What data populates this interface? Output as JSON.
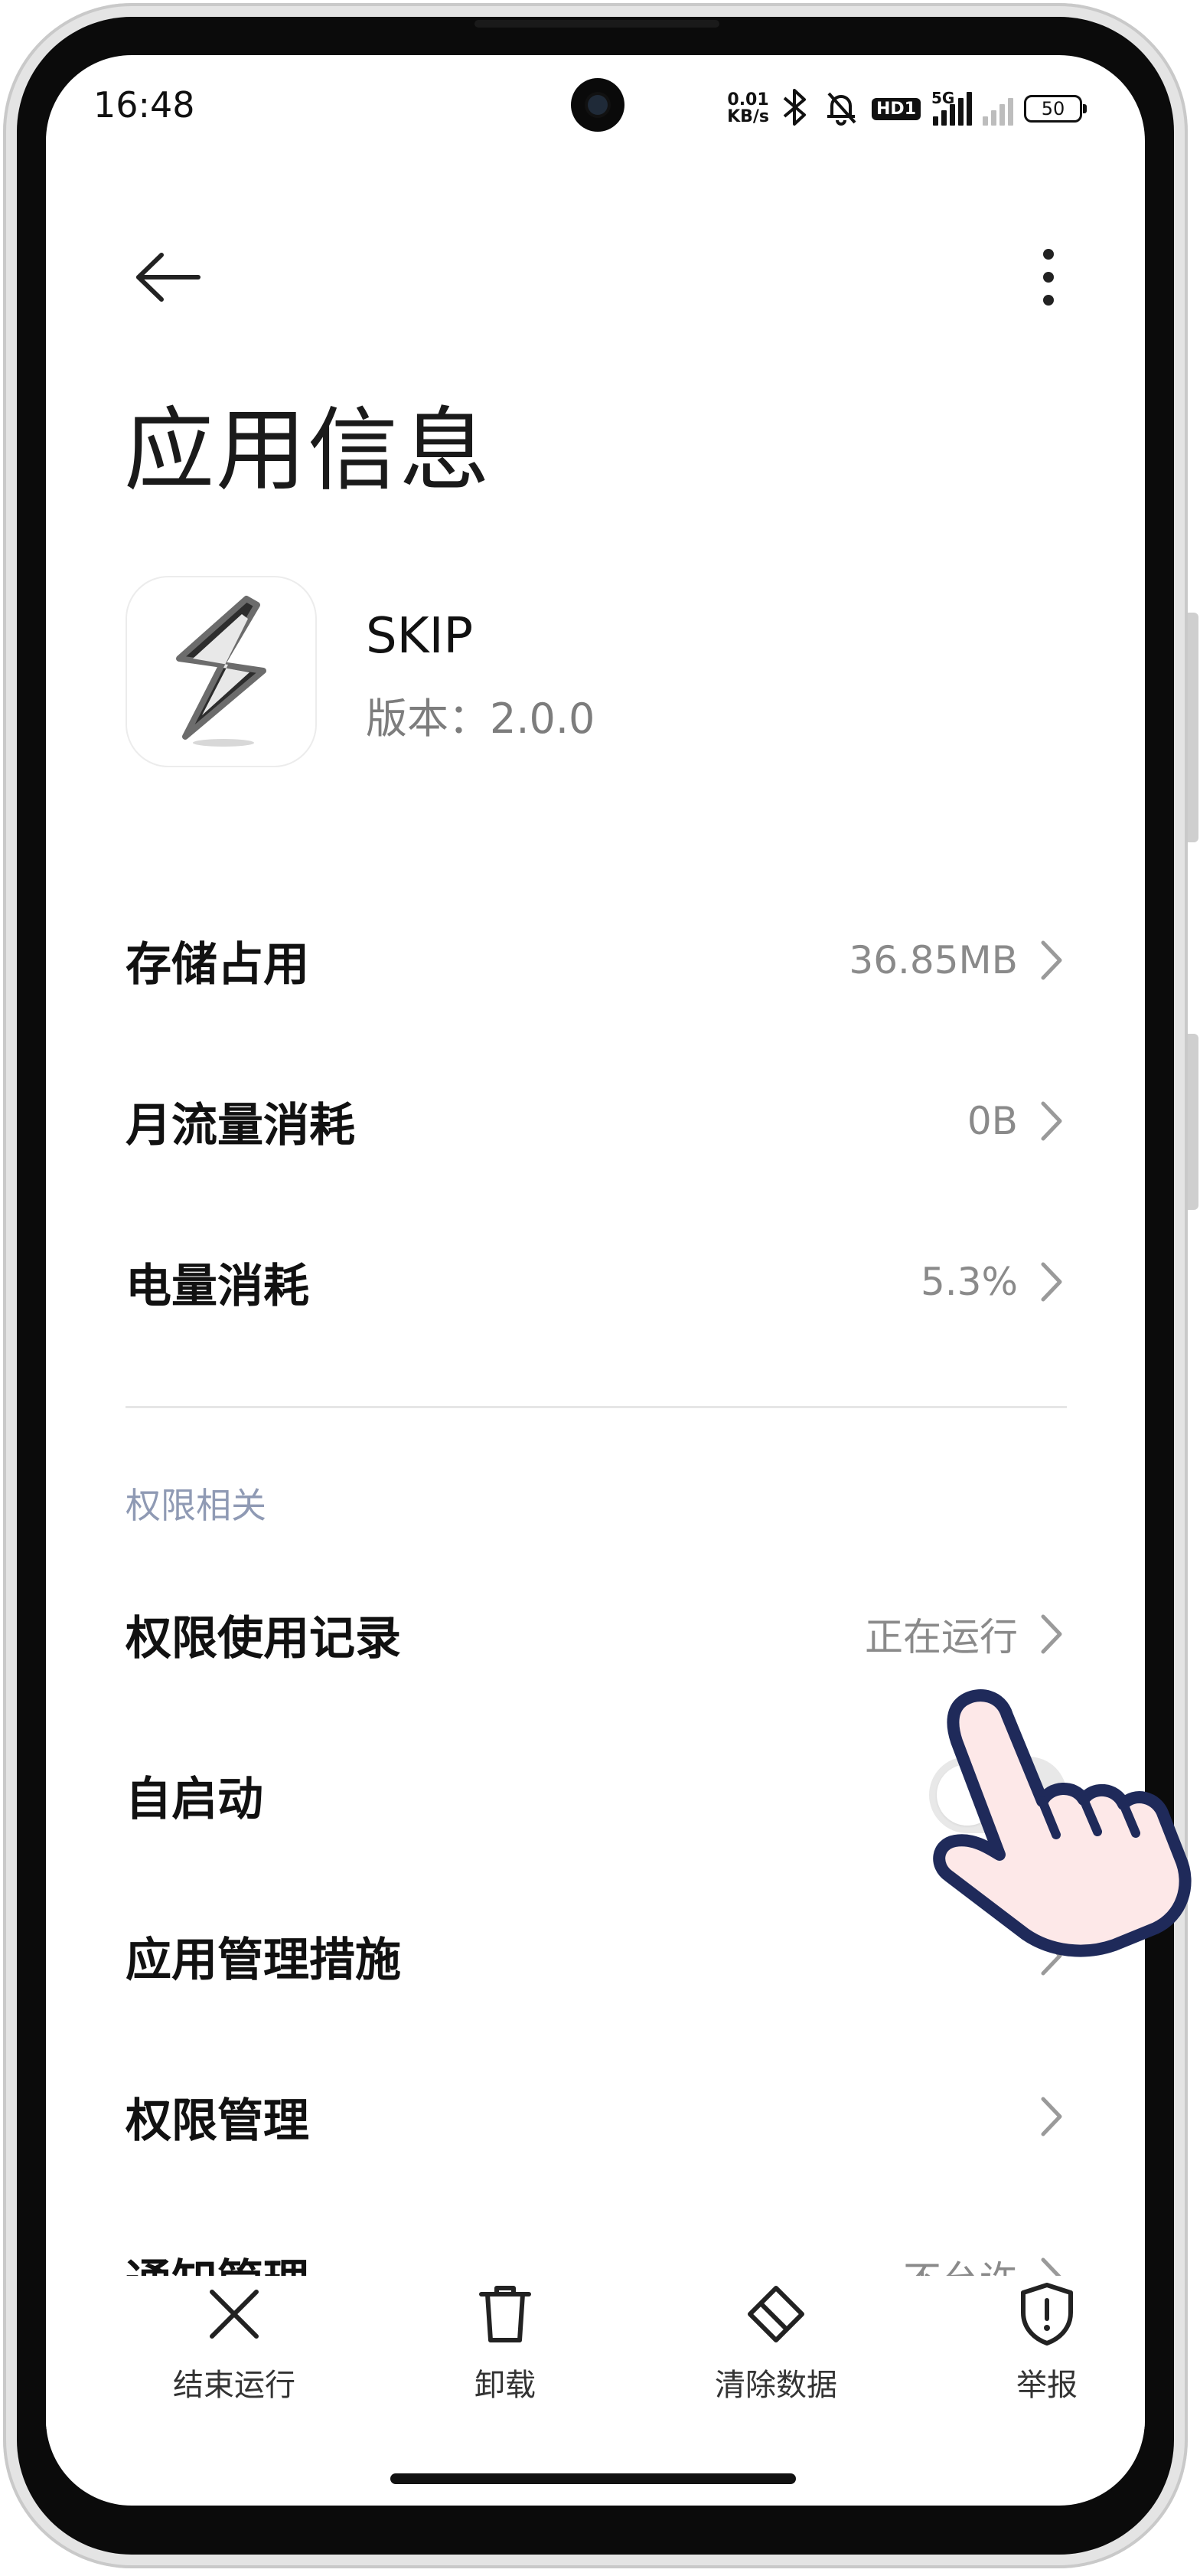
{
  "status_bar": {
    "time": "16:48",
    "net_speed_value": "0.01",
    "net_speed_unit": "KB/s",
    "hd_badge": "HD1",
    "network_type": "5G",
    "battery_level": "50"
  },
  "header": {
    "title": "应用信息"
  },
  "app": {
    "name": "SKIP",
    "version": "版本：2.0.0"
  },
  "usage_rows": [
    {
      "label": "存储占用",
      "value": "36.85MB"
    },
    {
      "label": "月流量消耗",
      "value": "0B"
    },
    {
      "label": "电量消耗",
      "value": "5.3%"
    }
  ],
  "permissions_section": {
    "title": "权限相关",
    "rows": [
      {
        "label": "权限使用记录",
        "value": "正在运行"
      },
      {
        "label": "自启动",
        "toggle_on": false
      },
      {
        "label": "应用管理措施",
        "value": ""
      },
      {
        "label": "权限管理",
        "value": ""
      },
      {
        "label": "通知管理",
        "value": "不允许"
      }
    ]
  },
  "bottom_actions": [
    {
      "label": "结束运行",
      "icon": "close-icon"
    },
    {
      "label": "卸载",
      "icon": "trash-icon"
    },
    {
      "label": "清除数据",
      "icon": "eraser-icon"
    },
    {
      "label": "举报",
      "icon": "shield-alert-icon"
    }
  ],
  "colors": {
    "section_title": "#8f9ab4",
    "value_text": "#8a8a8a",
    "hand_fill": "#fde8e8",
    "hand_outline": "#1f2a5a"
  }
}
